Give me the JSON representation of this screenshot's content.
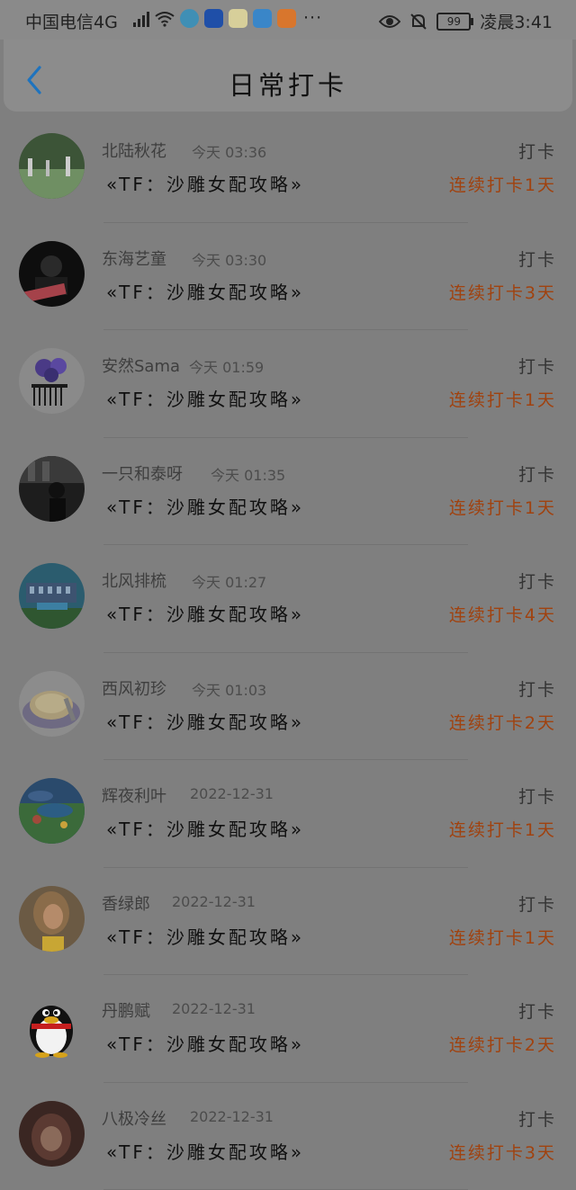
{
  "status_bar": {
    "carrier": "中国电信4G",
    "net_sup": "4G",
    "more": "···",
    "battery": "99",
    "time": "凌晨3:41"
  },
  "header": {
    "title": "日常打卡",
    "back_icon": "chevron-left-icon"
  },
  "colors": {
    "back_icon": "#1e73be",
    "streak_text": "#a0420f",
    "divider": "#737373"
  },
  "items": [
    {
      "name": "北陆秋花",
      "time": "今天 03:36",
      "title": "«TF：沙雕女配攻略»",
      "action": "打卡",
      "streak": "连续打卡1天"
    },
    {
      "name": "东海艺童",
      "time": "今天 03:30",
      "title": "«TF：沙雕女配攻略»",
      "action": "打卡",
      "streak": "连续打卡3天"
    },
    {
      "name": "安然Sama",
      "time": "今天 01:59",
      "title": "«TF：沙雕女配攻略»",
      "action": "打卡",
      "streak": "连续打卡1天"
    },
    {
      "name": "一只和泰呀",
      "time": "今天 01:35",
      "title": "«TF：沙雕女配攻略»",
      "action": "打卡",
      "streak": "连续打卡1天"
    },
    {
      "name": "北风排梳",
      "time": "今天 01:27",
      "title": "«TF：沙雕女配攻略»",
      "action": "打卡",
      "streak": "连续打卡4天"
    },
    {
      "name": "西风初珍",
      "time": "今天 01:03",
      "title": "«TF：沙雕女配攻略»",
      "action": "打卡",
      "streak": "连续打卡2天"
    },
    {
      "name": "辉夜利叶",
      "time": "2022-12-31",
      "title": "«TF：沙雕女配攻略»",
      "action": "打卡",
      "streak": "连续打卡1天"
    },
    {
      "name": "香绿郎",
      "time": "2022-12-31",
      "title": "«TF：沙雕女配攻略»",
      "action": "打卡",
      "streak": "连续打卡1天"
    },
    {
      "name": "丹鹏赋",
      "time": "2022-12-31",
      "title": "«TF：沙雕女配攻略»",
      "action": "打卡",
      "streak": "连续打卡2天"
    },
    {
      "name": "八极冷丝",
      "time": "2022-12-31",
      "title": "«TF：沙雕女配攻略»",
      "action": "打卡",
      "streak": "连续打卡3天"
    }
  ]
}
